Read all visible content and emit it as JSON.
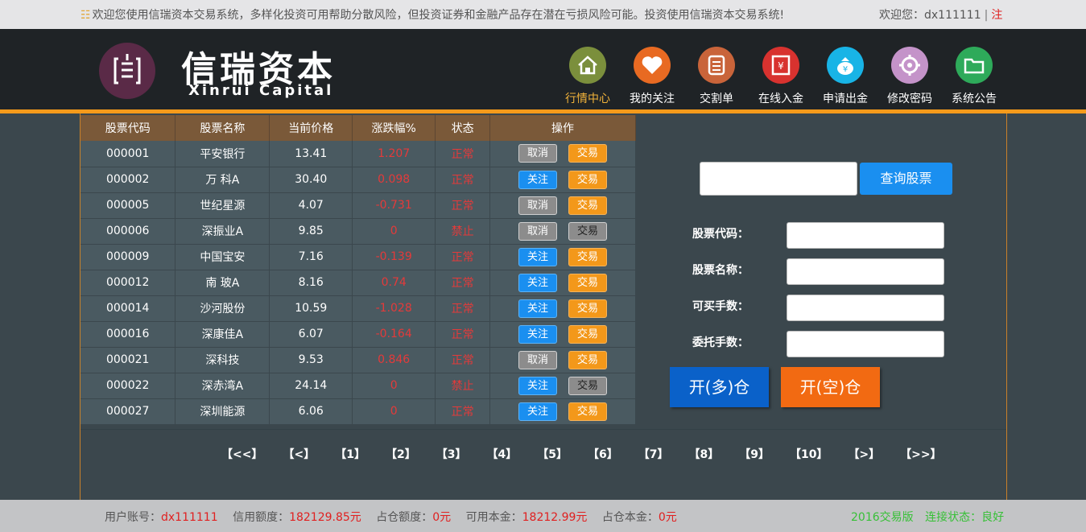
{
  "topbar": {
    "notice": "欢迎您使用信瑞资本交易系统，多样化投资可用帮助分散风险，但投资证券和金融产品存在潜在亏损风险可能。投资使用信瑞资本交易系统!",
    "welcome_prefix": "欢迎您：",
    "username": "dx111111",
    "separator": "|",
    "logout": "注"
  },
  "brand": {
    "name_cn": "信瑞资本",
    "name_en": "Xinrui Capital"
  },
  "nav": [
    {
      "label": "行情中心",
      "icon": "home-icon",
      "color": "#7b8f3c",
      "active": true
    },
    {
      "label": "我的关注",
      "icon": "heart-icon",
      "color": "#e86a22",
      "active": false
    },
    {
      "label": "交割单",
      "icon": "document-icon",
      "color": "#c9643a",
      "active": false
    },
    {
      "label": "在线入金",
      "icon": "deposit-icon",
      "color": "#d8322f",
      "active": false
    },
    {
      "label": "申请出金",
      "icon": "money-bag-icon",
      "color": "#18b4e6",
      "active": false
    },
    {
      "label": "修改密码",
      "icon": "gear-icon",
      "color": "#c493c9",
      "active": false
    },
    {
      "label": "系统公告",
      "icon": "folder-icon",
      "color": "#2eaa5a",
      "active": false
    }
  ],
  "table": {
    "headers": [
      "股票代码",
      "股票名称",
      "当前价格",
      "涨跌幅%",
      "状态",
      "操作"
    ],
    "rows": [
      {
        "code": "000001",
        "name": "平安银行",
        "price": "13.41",
        "change": "1.207",
        "status": "正常",
        "action1": "取消",
        "action2": "交易",
        "action1_type": "cancel",
        "trade_disabled": false
      },
      {
        "code": "000002",
        "name": "万 科A",
        "price": "30.40",
        "change": "0.098",
        "status": "正常",
        "action1": "关注",
        "action2": "交易",
        "action1_type": "follow",
        "trade_disabled": false
      },
      {
        "code": "000005",
        "name": "世纪星源",
        "price": "4.07",
        "change": "-0.731",
        "status": "正常",
        "action1": "取消",
        "action2": "交易",
        "action1_type": "cancel",
        "trade_disabled": false
      },
      {
        "code": "000006",
        "name": "深振业A",
        "price": "9.85",
        "change": "0",
        "status": "禁止",
        "action1": "取消",
        "action2": "交易",
        "action1_type": "cancel",
        "trade_disabled": true
      },
      {
        "code": "000009",
        "name": "中国宝安",
        "price": "7.16",
        "change": "-0.139",
        "status": "正常",
        "action1": "关注",
        "action2": "交易",
        "action1_type": "follow",
        "trade_disabled": false
      },
      {
        "code": "000012",
        "name": "南 玻A",
        "price": "8.16",
        "change": "0.74",
        "status": "正常",
        "action1": "关注",
        "action2": "交易",
        "action1_type": "follow",
        "trade_disabled": false
      },
      {
        "code": "000014",
        "name": "沙河股份",
        "price": "10.59",
        "change": "-1.028",
        "status": "正常",
        "action1": "关注",
        "action2": "交易",
        "action1_type": "follow",
        "trade_disabled": false
      },
      {
        "code": "000016",
        "name": "深康佳A",
        "price": "6.07",
        "change": "-0.164",
        "status": "正常",
        "action1": "关注",
        "action2": "交易",
        "action1_type": "follow",
        "trade_disabled": false
      },
      {
        "code": "000021",
        "name": "深科技",
        "price": "9.53",
        "change": "0.846",
        "status": "正常",
        "action1": "取消",
        "action2": "交易",
        "action1_type": "cancel",
        "trade_disabled": false
      },
      {
        "code": "000022",
        "name": "深赤湾A",
        "price": "24.14",
        "change": "0",
        "status": "禁止",
        "action1": "关注",
        "action2": "交易",
        "action1_type": "follow",
        "trade_disabled": true
      },
      {
        "code": "000027",
        "name": "深圳能源",
        "price": "6.06",
        "change": "0",
        "status": "正常",
        "action1": "关注",
        "action2": "交易",
        "action1_type": "follow",
        "trade_disabled": false
      }
    ]
  },
  "search": {
    "input_value": "",
    "button_label": "查询股票"
  },
  "form": {
    "code_label": "股票代码：",
    "name_label": "股票名称：",
    "buyable_label": "可买手数：",
    "order_label": "委托手数：",
    "long_button": "开(多)仓",
    "short_button": "开(空)仓"
  },
  "pager": [
    "【<<】",
    "【<】",
    "【1】",
    "【2】",
    "【3】",
    "【4】",
    "【5】",
    "【6】",
    "【7】",
    "【8】",
    "【9】",
    "【10】",
    "【>】",
    "【>>】"
  ],
  "footer": {
    "account_label": "用户账号：",
    "account_value": "dx111111",
    "credit_label": "信用额度：",
    "credit_value": "182129.85元",
    "occupied_label": "占仓额度：",
    "occupied_value": "0元",
    "available_label": "可用本金：",
    "available_value": "18212.99元",
    "position_label": "占仓本金：",
    "position_value": "0元",
    "version": "2016交易版",
    "connection": "连接状态：良好"
  }
}
